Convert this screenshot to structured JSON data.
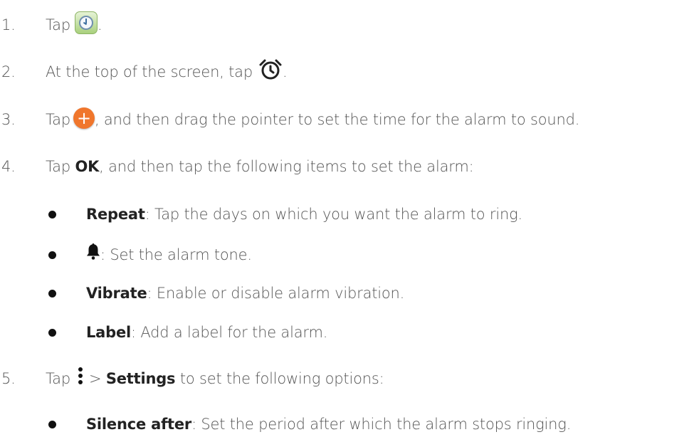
{
  "steps": [
    {
      "num": "1.",
      "a": "Tap",
      "b": "."
    },
    {
      "num": "2.",
      "a": "At the top of the screen, tap",
      "b": "."
    },
    {
      "num": "3.",
      "a": "Tap",
      "b": ", and then drag the pointer to set the time for the alarm to sound."
    },
    {
      "num": "4.",
      "a": "Tap ",
      "bold": "OK",
      "b": ", and then tap the following items to set the alarm:"
    },
    {
      "num": "5.",
      "a": "Tap",
      "bold": "Settings",
      "pre": "> ",
      "b": " to set the following options:"
    }
  ],
  "alarm_items": [
    {
      "bold": "Repeat",
      "text": ": Tap the days on which you want the alarm to ring."
    },
    {
      "bold": "",
      "text": ": Set the alarm tone."
    },
    {
      "bold": "Vibrate",
      "text": ": Enable or disable alarm vibration."
    },
    {
      "bold": "Label",
      "text": ": Add a label for the alarm."
    }
  ],
  "settings_items": [
    {
      "bold": "Silence after",
      "text": ": Set the period after which the alarm stops ringing."
    }
  ],
  "icons": {
    "clock_app": "clock-app-icon",
    "alarm": "alarm-clock-icon",
    "add": "add-alarm-icon",
    "bell": "bell-icon",
    "more": "more-options-icon",
    "add_glyph": "+"
  },
  "colors": {
    "text": "#555555",
    "bold_text": "#222222",
    "add_button": "#f0762c"
  }
}
